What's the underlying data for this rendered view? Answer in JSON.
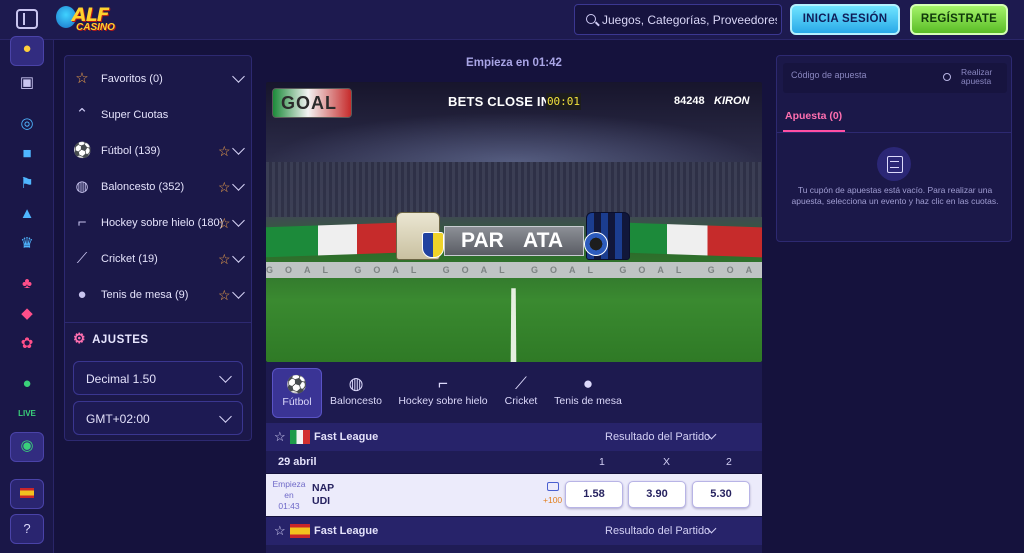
{
  "header": {
    "logo_text": "ALF",
    "logo_sub": "CASINO",
    "search_placeholder": "Juegos, Categorías, Proveedores",
    "login_label": "INICIA SESIÓN",
    "register_label": "REGÍSTRATE"
  },
  "rail": {
    "icons": [
      "bonus-wheel-icon",
      "gift-icon",
      "award-icon",
      "briefcase-icon",
      "flag-icon",
      "bag-icon",
      "crown-icon",
      "cherry-icon",
      "dice-icon",
      "clover-icon",
      "football-icon",
      "live-icon",
      "gamepad-icon",
      "spain-flag-icon",
      "help-icon"
    ]
  },
  "sidebar": {
    "items": [
      {
        "icon": "star-icon",
        "label": "Favoritos (0)"
      },
      {
        "icon": "super-odds-icon",
        "label": "Super Cuotas"
      },
      {
        "icon": "football-icon",
        "label": "Fútbol (139)"
      },
      {
        "icon": "basketball-icon",
        "label": "Baloncesto (352)"
      },
      {
        "icon": "hockey-icon",
        "label": "Hockey sobre hielo (180)"
      },
      {
        "icon": "cricket-icon",
        "label": "Cricket (19)"
      },
      {
        "icon": "table-tennis-icon",
        "label": "Tenis de mesa (9)"
      }
    ],
    "settings_title": "AJUSTES",
    "odds_format": "Decimal 1.50",
    "timezone": "GMT+02:00"
  },
  "main": {
    "starts_in": "Empieza en 01:42",
    "video": {
      "goal_logo": "GOAL",
      "bets_close_label": "BETS CLOSE IN:",
      "timer": "00:01",
      "event_number": "84248",
      "provider": "KIRON",
      "home_abbr": "PAR",
      "away_abbr": "ATA",
      "board_text": "GOAL GOAL GOAL GOAL GOAL GOAL GOAL GOAL GOAL GOAL GOAL GOAL"
    },
    "tabs": [
      {
        "icon": "football-icon",
        "label": "Fútbol",
        "active": true
      },
      {
        "icon": "basketball-icon",
        "label": "Baloncesto",
        "active": false
      },
      {
        "icon": "hockey-icon",
        "label": "Hockey sobre hielo",
        "active": false
      },
      {
        "icon": "cricket-icon",
        "label": "Cricket",
        "active": false
      },
      {
        "icon": "table-tennis-icon",
        "label": "Tenis de mesa",
        "active": false
      }
    ],
    "leagues": [
      {
        "flag": "italy",
        "name": "Fast League",
        "market": "Resultado del Partido"
      },
      {
        "flag": "spain",
        "name": "Fast League",
        "market": "Resultado del Partido"
      }
    ],
    "date": "29 abril",
    "columns": [
      "1",
      "X",
      "2"
    ],
    "match": {
      "status_line1": "Empieza",
      "status_line2": "en",
      "status_time": "01:43",
      "home": "NAP",
      "away": "UDI",
      "more_markets": "+100",
      "odds": [
        "1.58",
        "3.90",
        "5.30"
      ]
    }
  },
  "betslip": {
    "code_placeholder": "Código de apuesta",
    "do_bet": "Realizar apuesta",
    "tab_label": "Apuesta (0)",
    "empty_text": "Tu cupón de apuestas está vacío. Para realizar una apuesta, selecciona un evento y haz clic en las cuotas."
  },
  "colors": {
    "background": "#15123d",
    "panel": "#1b1849",
    "accent_pink": "#ff4fa3",
    "login_cyan": "#29a9e8",
    "register_green": "#5abd26",
    "star_orange": "#f1a34a"
  }
}
